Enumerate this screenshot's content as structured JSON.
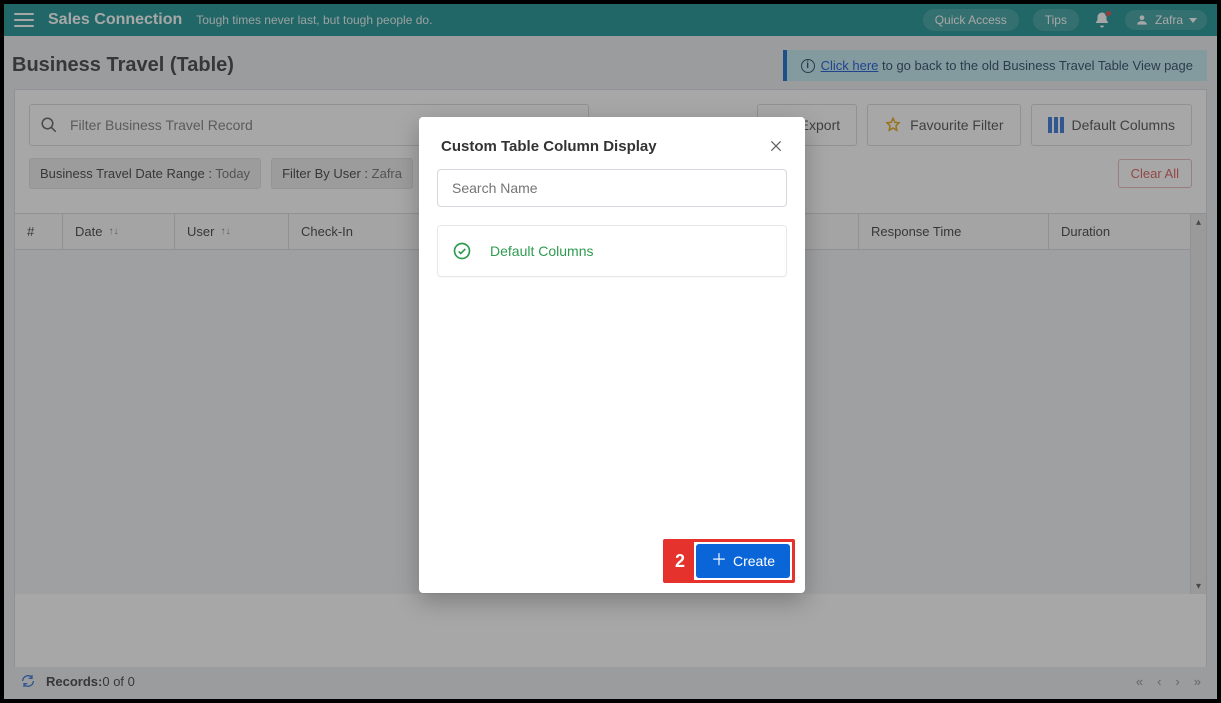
{
  "topbar": {
    "brand": "Sales Connection",
    "tagline": "Tough times never last, but tough people do.",
    "quick_access": "Quick Access",
    "tips": "Tips",
    "user": "Zafra"
  },
  "page": {
    "title": "Business Travel (Table)",
    "banner_link": "Click here",
    "banner_rest": " to go back to the old Business Travel Table View page"
  },
  "toolbar": {
    "search_placeholder": "Filter Business Travel Record",
    "export": "Export",
    "favourite": "Favourite Filter",
    "default_columns": "Default Columns",
    "chip_date_label": "Business Travel Date Range :",
    "chip_date_value": " Today",
    "chip_user_label": "Filter By User :",
    "chip_user_value": " Zafra",
    "clear_all": "Clear All"
  },
  "table": {
    "headers": {
      "num": "#",
      "date": "Date",
      "user": "User",
      "checkin": "Check-In",
      "resp": "Response Time",
      "dur": "Duration"
    }
  },
  "footer": {
    "records_label": "Records:",
    "records_value": " 0  of  0"
  },
  "modal": {
    "title": "Custom Table Column Display",
    "search_placeholder": "Search Name",
    "option_default": "Default Columns",
    "callout_num": "2",
    "create": "Create"
  }
}
